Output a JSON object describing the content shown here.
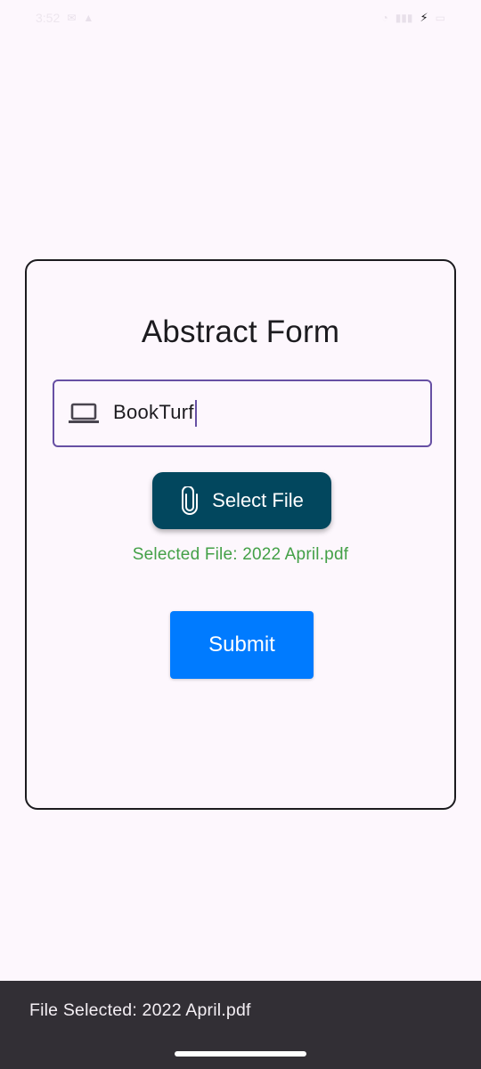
{
  "status_bar": {
    "time": "3:52"
  },
  "form": {
    "title": "Abstract Form",
    "input": {
      "icon": "laptop-icon",
      "value": "BookTurf"
    },
    "select_file_button": {
      "icon": "paperclip-icon",
      "label": "Select File"
    },
    "selected_file_text": "Selected File: 2022 April.pdf",
    "submit_label": "Submit"
  },
  "snackbar": {
    "message": "File Selected: 2022 April.pdf"
  },
  "colors": {
    "background": "#FDF7FD",
    "input_border": "#6750A4",
    "select_button": "#02475E",
    "selected_text": "#43A047",
    "submit_button": "#007BFF",
    "snackbar": "#322F35"
  }
}
